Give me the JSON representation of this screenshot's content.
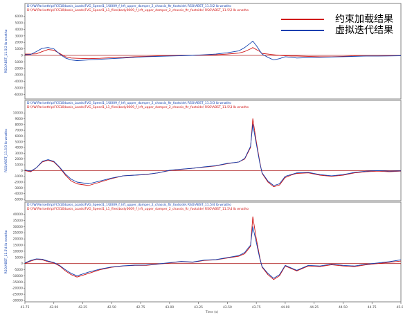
{
  "colors": {
    "constrained": "#d01010",
    "virtual": "#1040b0",
    "zero_line": "#b02020",
    "frame": "#808080",
    "grid": "#c8c8c8"
  },
  "legend": {
    "constrained_label": "约束加载结果",
    "virtual_label": "虚拟迭代结果"
  },
  "x_axis_title": "Time (s)",
  "chart_data": {
    "type": "line",
    "x_ticks": [
      "41.75",
      "42.00",
      "42.25",
      "42.50",
      "42.75",
      "43.00",
      "43.25",
      "43.50",
      "43.75",
      "44.00",
      "44.25",
      "44.50",
      "44.75",
      "45.00"
    ],
    "xlim": [
      41.75,
      45.0
    ],
    "panels": [
      {
        "header_virtual": "D:\\YW\\Pariseth\\p\\FCS10\\basis_Loads\\FVG_Speed1_1\\0009_f_lrft_upper_damper_2_chassis_ftr_footside\\ RSO\\ABST_11.5\\2 lb wnatho",
        "header_constrained": "D:\\YW\\Pariseth\\p\\FCS10\\basis_Loads\\FVG_Speed1_L1_files\\body0009_f_lrft_upper_damper_2_chassis_ftr_footside\\ RSO\\ABST_11.5\\2 lb wnatho",
        "ylabel": "RSO/ABST_11.5\\2 lb wnatho",
        "y_ticks": [
          "6000",
          "5000",
          "4000",
          "3000",
          "2000",
          "1000",
          "0",
          "-1000",
          "-2000",
          "-3000",
          "-4000",
          "-5000",
          "-6000"
        ],
        "ylim": [
          -6500,
          6500
        ],
        "x": [
          41.75,
          41.8,
          41.85,
          41.9,
          41.95,
          42.0,
          42.05,
          42.1,
          42.15,
          42.2,
          42.3,
          42.4,
          42.5,
          42.6,
          42.7,
          42.8,
          42.9,
          43.0,
          43.1,
          43.2,
          43.3,
          43.4,
          43.5,
          43.6,
          43.65,
          43.7,
          43.72,
          43.75,
          43.78,
          43.8,
          43.85,
          43.9,
          43.95,
          44.0,
          44.05,
          44.1,
          44.2,
          44.3,
          44.4,
          44.5,
          44.6,
          44.7,
          44.8,
          44.9,
          45.0
        ],
        "series": [
          {
            "name": "约束加载结果",
            "values": [
              200,
              200,
              250,
              600,
              900,
              800,
              300,
              -200,
              -400,
              -450,
              -500,
              -450,
              -350,
              -300,
              -200,
              -150,
              -100,
              -50,
              0,
              0,
              50,
              100,
              200,
              350,
              600,
              1000,
              1200,
              900,
              600,
              300,
              200,
              100,
              0,
              -50,
              -100,
              -100,
              -150,
              -200,
              -200,
              -150,
              -100,
              -80,
              -80,
              -50,
              -50
            ]
          },
          {
            "name": "虚拟迭代结果",
            "values": [
              100,
              150,
              600,
              1100,
              1200,
              1000,
              200,
              -400,
              -700,
              -800,
              -700,
              -600,
              -500,
              -400,
              -300,
              -200,
              -150,
              -100,
              -50,
              0,
              100,
              200,
              400,
              700,
              1200,
              1900,
              2200,
              1500,
              700,
              200,
              -300,
              -700,
              -500,
              -200,
              -300,
              -400,
              -350,
              -300,
              -250,
              -200,
              -150,
              -100,
              -100,
              -80,
              -50
            ]
          }
        ]
      },
      {
        "header_virtual": "D:\\YW\\Pariseth\\p\\FCS10\\basis_Loads\\FVG_Speed1_1\\0009_f_lrft_upper_damper_2_chassis_ftr_footside\\ RSO\\ABST_11.5\\3 lb wnatho",
        "header_constrained": "D:\\YW\\Pariseth\\p\\FCS10\\basis_Loads\\FVG_Speed1_L1_files\\body0009_f_lrft_upper_damper_2_chassis_ftr_footside\\ RSO\\ABST_11.5\\3 lb wnatho",
        "ylabel": "RSO/ABST_11.5\\3 lb wnatho",
        "y_ticks": [
          "10000",
          "9000",
          "8000",
          "7000",
          "6000",
          "5000",
          "4000",
          "3000",
          "2000",
          "1000",
          "0",
          "-1000",
          "-2000",
          "-3000",
          "-4000",
          "-5000"
        ],
        "ylim": [
          -5000,
          10500
        ],
        "x": [
          41.75,
          41.8,
          41.85,
          41.9,
          41.95,
          42.0,
          42.05,
          42.1,
          42.15,
          42.2,
          42.3,
          42.4,
          42.5,
          42.6,
          42.7,
          42.8,
          42.9,
          43.0,
          43.1,
          43.2,
          43.3,
          43.4,
          43.5,
          43.6,
          43.65,
          43.7,
          43.72,
          43.75,
          43.78,
          43.8,
          43.85,
          43.9,
          43.95,
          44.0,
          44.05,
          44.1,
          44.2,
          44.3,
          44.4,
          44.5,
          44.6,
          44.7,
          44.8,
          44.9,
          45.0
        ],
        "series": [
          {
            "name": "约束加载结果",
            "values": [
              0,
              -200,
              500,
              1500,
              1800,
              1500,
              500,
              -800,
              -1800,
              -2300,
              -2600,
              -2000,
              -1400,
              -900,
              -800,
              -700,
              -400,
              0,
              200,
              400,
              600,
              800,
              1200,
              1500,
              2000,
              4000,
              9000,
              5000,
              1500,
              -500,
              -2000,
              -2800,
              -2500,
              -1200,
              -800,
              -500,
              -400,
              -800,
              -1000,
              -800,
              -400,
              -200,
              -100,
              -200,
              -100
            ]
          },
          {
            "name": "虚拟迭代结果",
            "values": [
              100,
              -100,
              500,
              1600,
              1900,
              1600,
              600,
              -600,
              -1500,
              -2000,
              -2300,
              -1800,
              -1300,
              -900,
              -800,
              -650,
              -400,
              50,
              250,
              400,
              650,
              850,
              1250,
              1500,
              2100,
              4200,
              8000,
              4600,
              1300,
              -400,
              -1800,
              -2600,
              -2300,
              -1000,
              -700,
              -400,
              -300,
              -700,
              -900,
              -700,
              -300,
              -100,
              0,
              -100,
              -50
            ]
          }
        ]
      },
      {
        "header_virtual": "D:\\YW\\Pariseth\\p\\FCS10\\basis_Loads\\FVG_Speed1_1\\0009_f_lrft_upper_damper_2_chassis_ftr_footside\\ RSO\\ABST_11.5\\4 lb wnatho",
        "header_constrained": "D:\\YW\\Pariseth\\p\\FCS10\\basis_Loads\\FVG_Speed1_L1_files\\body0009_f_lrft_upper_damper_2_chassis_ftr_footside\\ RSO\\ABST_11.5\\4 lb wnatho",
        "ylabel": "RSO/ABST_11.5\\4 lb wnatho",
        "y_ticks": [
          "40000",
          "35000",
          "30000",
          "25000",
          "20000",
          "15000",
          "10000",
          "5000",
          "0",
          "-5000",
          "-10000",
          "-15000",
          "-20000",
          "-25000",
          "-30000"
        ],
        "ylim": [
          -30000,
          42000
        ],
        "x": [
          41.75,
          41.8,
          41.85,
          41.9,
          41.95,
          42.0,
          42.05,
          42.1,
          42.15,
          42.2,
          42.3,
          42.4,
          42.5,
          42.6,
          42.7,
          42.8,
          42.9,
          43.0,
          43.1,
          43.2,
          43.3,
          43.4,
          43.5,
          43.6,
          43.65,
          43.7,
          43.72,
          43.75,
          43.78,
          43.8,
          43.85,
          43.9,
          43.95,
          44.0,
          44.05,
          44.1,
          44.2,
          44.3,
          44.4,
          44.5,
          44.6,
          44.7,
          44.8,
          44.9,
          45.0
        ],
        "series": [
          {
            "name": "约束加载结果",
            "values": [
              0,
              2000,
              3500,
              3000,
              1500,
              500,
              -2000,
              -6000,
              -9000,
              -11000,
              -8000,
              -5000,
              -3000,
              -2000,
              -1500,
              -1500,
              -500,
              500,
              1500,
              1000,
              2500,
              3000,
              4500,
              6000,
              8000,
              14000,
              38000,
              20000,
              5000,
              -3000,
              -9000,
              -13000,
              -10000,
              -2000,
              -4000,
              -6000,
              -2000,
              -2500,
              -1000,
              -2000,
              -2500,
              -1000,
              0,
              1000,
              2000
            ]
          },
          {
            "name": "虚拟迭代结果",
            "values": [
              500,
              2500,
              3800,
              3500,
              2000,
              800,
              -1500,
              -5000,
              -8000,
              -10000,
              -7000,
              -4500,
              -2800,
              -1800,
              -1300,
              -1200,
              -300,
              700,
              1700,
              1200,
              2800,
              3200,
              4800,
              6500,
              9000,
              15000,
              30000,
              17000,
              4000,
              -2500,
              -8000,
              -12000,
              -9000,
              -1500,
              -3500,
              -5500,
              -1500,
              -2000,
              -500,
              -1500,
              -2000,
              -500,
              500,
              1500,
              3000
            ]
          }
        ]
      }
    ]
  }
}
